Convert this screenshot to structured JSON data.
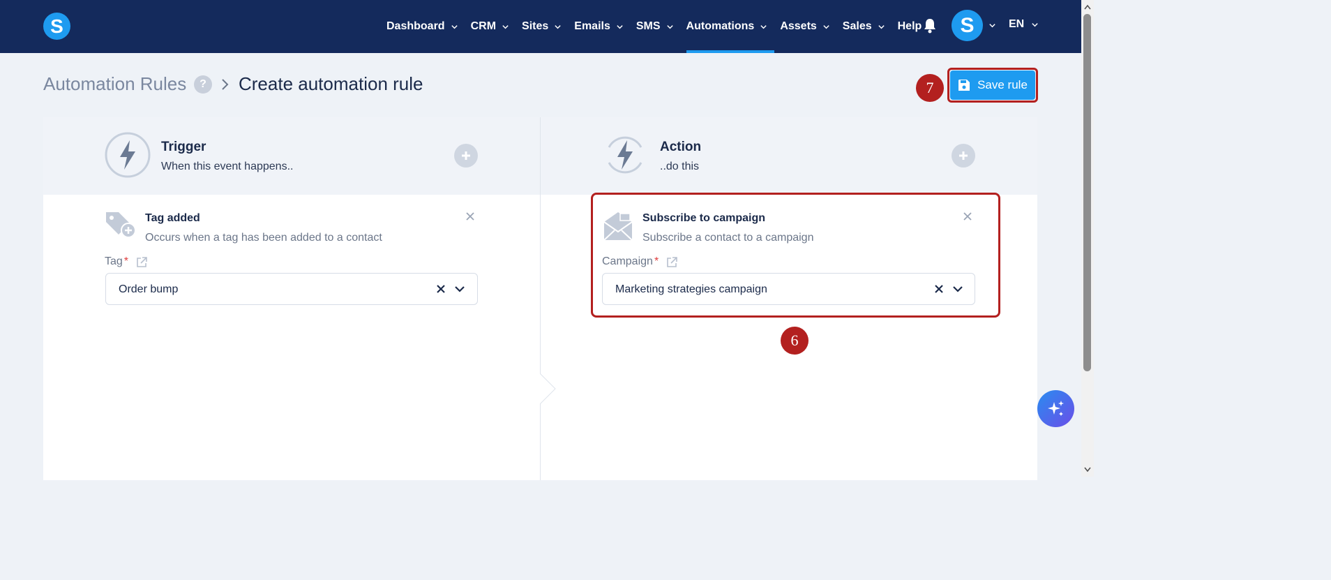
{
  "brand": {
    "logo_letter": "S",
    "accent": "#1e9bf0",
    "nav_bg": "#142a5c"
  },
  "nav": {
    "items": [
      {
        "label": "Dashboard",
        "dropdown": true
      },
      {
        "label": "CRM",
        "dropdown": true
      },
      {
        "label": "Sites",
        "dropdown": true
      },
      {
        "label": "Emails",
        "dropdown": true
      },
      {
        "label": "SMS",
        "dropdown": true
      },
      {
        "label": "Automations",
        "dropdown": true,
        "active": true
      },
      {
        "label": "Assets",
        "dropdown": true
      },
      {
        "label": "Sales",
        "dropdown": true
      },
      {
        "label": "Help",
        "dropdown": false
      }
    ],
    "avatar_letter": "S",
    "language": "EN"
  },
  "breadcrumb": {
    "root": "Automation Rules",
    "help_glyph": "?",
    "current": "Create automation rule"
  },
  "save_button": {
    "label": "Save rule",
    "step_badge": "7"
  },
  "trigger": {
    "title": "Trigger",
    "subtitle": "When this event happens..",
    "item": {
      "title": "Tag added",
      "description": "Occurs when a tag has been added to a contact",
      "field_label": "Tag",
      "required_mark": "*",
      "value": "Order bump"
    }
  },
  "action": {
    "title": "Action",
    "subtitle": "..do this",
    "item": {
      "title": "Subscribe to campaign",
      "description": "Subscribe a contact to a campaign",
      "field_label": "Campaign",
      "required_mark": "*",
      "value": "Marketing strategies campaign"
    },
    "step_badge": "6"
  },
  "annotation_color": "#b3201f"
}
